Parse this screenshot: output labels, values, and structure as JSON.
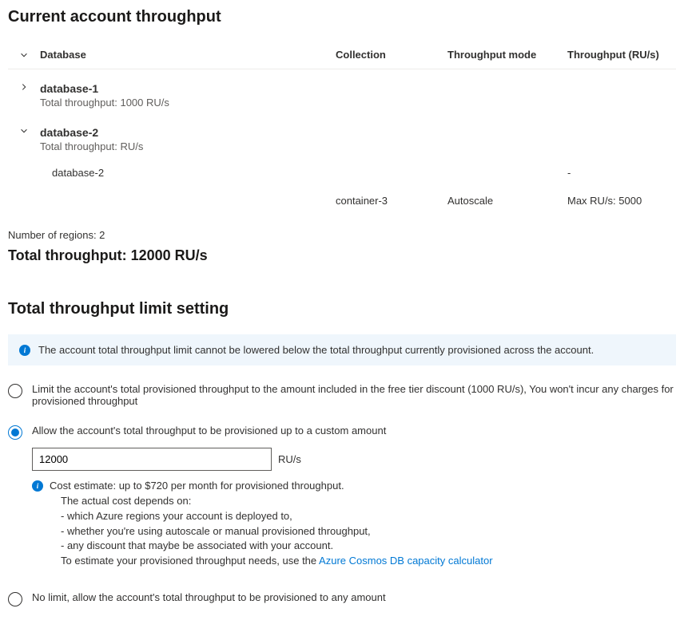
{
  "mainHeading": "Current account throughput",
  "table": {
    "headers": {
      "database": "Database",
      "collection": "Collection",
      "mode": "Throughput mode",
      "throughput": "Throughput (RU/s)"
    },
    "databases": [
      {
        "name": "database-1",
        "subLabel": "Total throughput: 1000 RU/s",
        "expanded": false,
        "children": []
      },
      {
        "name": "database-2",
        "subLabel": "Total throughput: RU/s",
        "expanded": true,
        "children": [
          {
            "database": "database-2",
            "collection": "",
            "mode": "",
            "throughput": "-"
          },
          {
            "database": "",
            "collection": "container-3",
            "mode": "Autoscale",
            "throughput": "Max RU/s: 5000"
          }
        ]
      }
    ]
  },
  "regionsLabel": "Number of regions: 2",
  "totalThroughput": "Total throughput: 12000 RU/s",
  "limitHeading": "Total throughput limit setting",
  "infoBanner": "The account total throughput limit cannot be lowered below the total throughput currently provisioned across the account.",
  "options": {
    "freeTier": "Limit the account's total provisioned throughput to the amount included in the free tier discount (1000 RU/s), You won't incur any charges for provisioned throughput",
    "custom": "Allow the account's total throughput to be provisioned up to a custom amount",
    "noLimit": "No limit, allow the account's total throughput to be provisioned to any amount"
  },
  "customInput": {
    "value": "12000",
    "unit": "RU/s"
  },
  "costEstimate": {
    "line1": "Cost estimate: up to $720 per month for provisioned throughput.",
    "line2": "The actual cost depends on:",
    "bullets": [
      "- which Azure regions your account is deployed to,",
      "- whether you're using autoscale or manual provisioned throughput,",
      "- any discount that maybe be associated with your account."
    ],
    "footerPrefix": "To estimate your provisioned throughput needs, use the ",
    "linkText": "Azure Cosmos DB capacity calculator"
  }
}
